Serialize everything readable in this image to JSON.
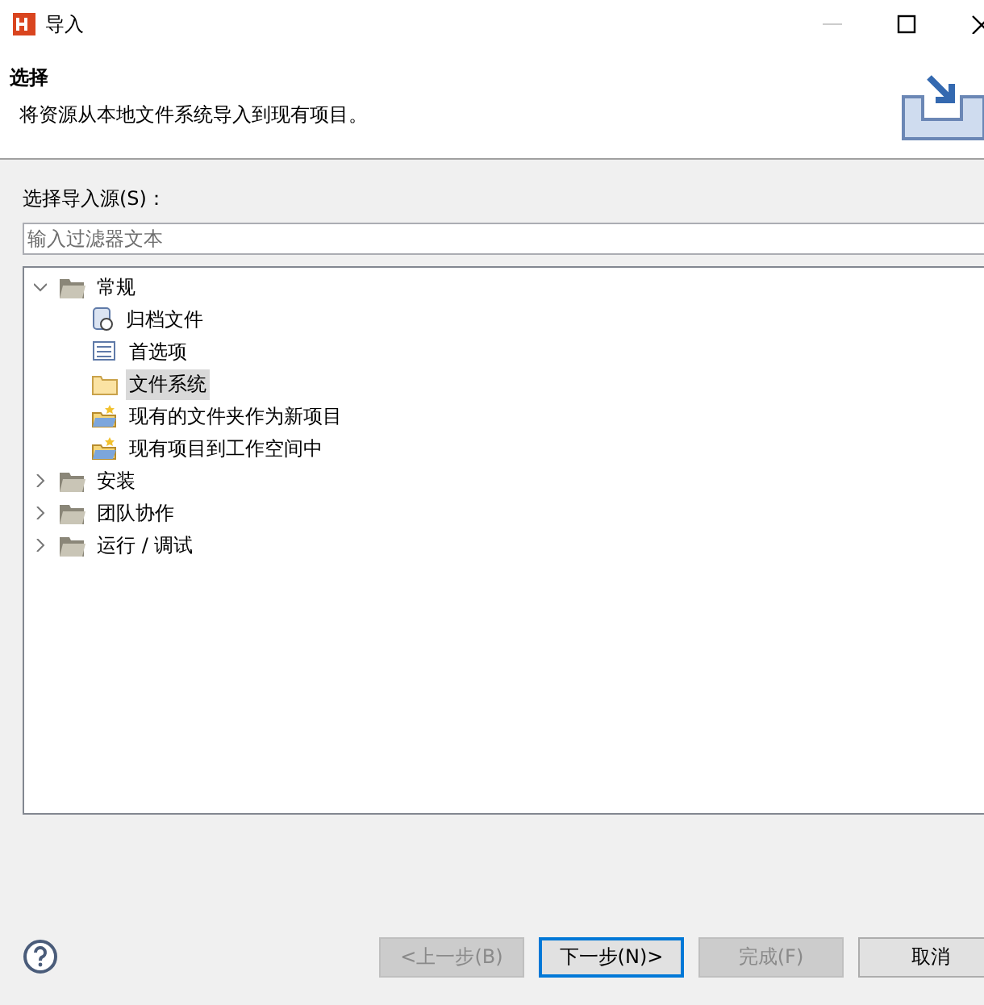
{
  "window": {
    "title": "导入"
  },
  "header": {
    "title": "选择",
    "description": "将资源从本地文件系统导入到现有项目。"
  },
  "source_label": "选择导入源(S)：",
  "filter": {
    "placeholder": "输入过滤器文本"
  },
  "tree": [
    {
      "label": "常规",
      "kind": "folder",
      "expanded": true,
      "selected": false,
      "children": [
        {
          "label": "归档文件",
          "kind": "archive",
          "selected": false
        },
        {
          "label": "首选项",
          "kind": "preferences",
          "selected": false
        },
        {
          "label": "文件系统",
          "kind": "open-folder",
          "selected": true
        },
        {
          "label": "现有的文件夹作为新项目",
          "kind": "project",
          "selected": false
        },
        {
          "label": "现有项目到工作空间中",
          "kind": "project",
          "selected": false
        }
      ]
    },
    {
      "label": "安装",
      "kind": "folder",
      "expanded": false,
      "selected": false
    },
    {
      "label": "团队协作",
      "kind": "folder",
      "expanded": false,
      "selected": false
    },
    {
      "label": "运行 / 调试",
      "kind": "folder",
      "expanded": false,
      "selected": false
    }
  ],
  "buttons": [
    {
      "label": "<上一步(B)",
      "disabled": true,
      "default": false
    },
    {
      "label": "下一步(N)>",
      "disabled": false,
      "default": true
    },
    {
      "label": "完成(F)",
      "disabled": true,
      "default": false
    },
    {
      "label": "取消",
      "disabled": false,
      "default": false
    }
  ]
}
